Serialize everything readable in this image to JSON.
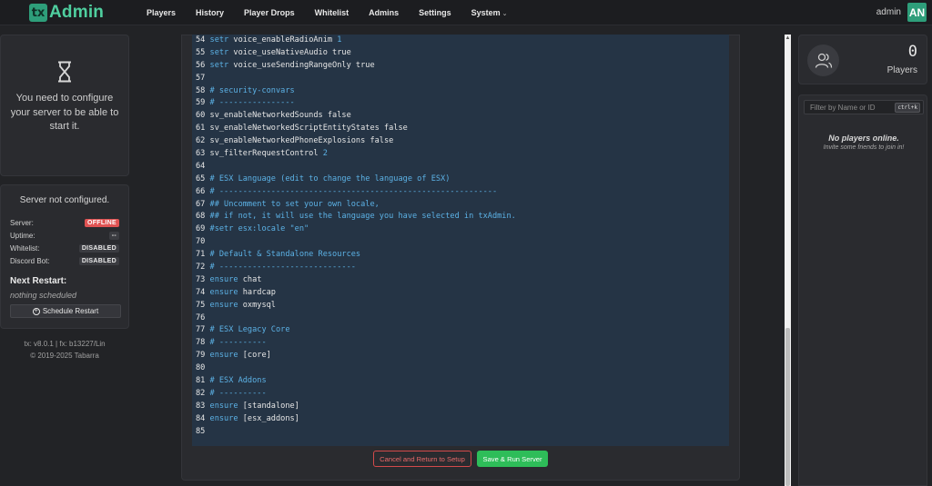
{
  "brand": {
    "tx": "tx",
    "name": "Admin"
  },
  "nav": {
    "items": [
      "Players",
      "History",
      "Player Drops",
      "Whitelist",
      "Admins",
      "Settings",
      "System"
    ],
    "user": "admin",
    "avatar": "AN"
  },
  "left": {
    "config_message": "You need to configure your server to be able to start it.",
    "status_title": "Server not configured.",
    "rows": [
      {
        "label": "Server:",
        "value": "OFFLINE"
      },
      {
        "label": "Uptime:",
        "value": "--"
      },
      {
        "label": "Whitelist:",
        "value": "DISABLED"
      },
      {
        "label": "Discord Bot:",
        "value": "DISABLED"
      }
    ],
    "next_restart_title": "Next Restart:",
    "next_restart_value": "nothing scheduled",
    "schedule_button": "Schedule Restart",
    "version_line": "tx: v8.0.1 | fx: b13227/Lin",
    "copyright": "© 2019-2025 Tabarra"
  },
  "editor": {
    "lines": [
      {
        "n": "54",
        "parts": [
          [
            "kw",
            "setr"
          ],
          [
            "t",
            " voice_enableRadioAnim "
          ],
          [
            "kw",
            "1"
          ]
        ]
      },
      {
        "n": "55",
        "parts": [
          [
            "kw",
            "setr"
          ],
          [
            "t",
            " voice_useNativeAudio true"
          ]
        ]
      },
      {
        "n": "56",
        "parts": [
          [
            "kw",
            "setr"
          ],
          [
            "t",
            " voice_useSendingRangeOnly true"
          ]
        ]
      },
      {
        "n": "57",
        "parts": []
      },
      {
        "n": "58",
        "parts": [
          [
            "cm",
            "# security-convars"
          ]
        ]
      },
      {
        "n": "59",
        "parts": [
          [
            "cm",
            "# ----------------"
          ]
        ]
      },
      {
        "n": "60",
        "parts": [
          [
            "t",
            "sv_enableNetworkedSounds false"
          ]
        ]
      },
      {
        "n": "61",
        "parts": [
          [
            "t",
            "sv_enableNetworkedScriptEntityStates false"
          ]
        ]
      },
      {
        "n": "62",
        "parts": [
          [
            "t",
            "sv_enableNetworkedPhoneExplosions false"
          ]
        ]
      },
      {
        "n": "63",
        "parts": [
          [
            "t",
            "sv_filterRequestControl "
          ],
          [
            "kw",
            "2"
          ]
        ]
      },
      {
        "n": "64",
        "parts": []
      },
      {
        "n": "65",
        "parts": [
          [
            "cm",
            "# ESX Language (edit to change the language of ESX)"
          ]
        ]
      },
      {
        "n": "66",
        "parts": [
          [
            "cm",
            "# -----------------------------------------------------------"
          ]
        ]
      },
      {
        "n": "67",
        "parts": [
          [
            "cm",
            "## Uncomment to set your own locale,"
          ]
        ]
      },
      {
        "n": "68",
        "parts": [
          [
            "cm",
            "## if not, it will use the language you have selected in txAdmin."
          ]
        ]
      },
      {
        "n": "69",
        "parts": [
          [
            "cm",
            "#setr esx:locale \"en\""
          ]
        ]
      },
      {
        "n": "70",
        "parts": []
      },
      {
        "n": "71",
        "parts": [
          [
            "cm",
            "# Default & Standalone Resources"
          ]
        ]
      },
      {
        "n": "72",
        "parts": [
          [
            "cm",
            "# -----------------------------"
          ]
        ]
      },
      {
        "n": "73",
        "parts": [
          [
            "kw",
            "ensure"
          ],
          [
            "t",
            " chat"
          ]
        ]
      },
      {
        "n": "74",
        "parts": [
          [
            "kw",
            "ensure"
          ],
          [
            "t",
            " hardcap"
          ]
        ]
      },
      {
        "n": "75",
        "parts": [
          [
            "kw",
            "ensure"
          ],
          [
            "t",
            " oxmysql"
          ]
        ]
      },
      {
        "n": "76",
        "parts": []
      },
      {
        "n": "77",
        "parts": [
          [
            "cm",
            "# ESX Legacy Core"
          ]
        ]
      },
      {
        "n": "78",
        "parts": [
          [
            "cm",
            "# ----------"
          ]
        ]
      },
      {
        "n": "79",
        "parts": [
          [
            "kw",
            "ensure"
          ],
          [
            "t",
            " [core]"
          ]
        ]
      },
      {
        "n": "80",
        "parts": []
      },
      {
        "n": "81",
        "parts": [
          [
            "cm",
            "# ESX Addons"
          ]
        ]
      },
      {
        "n": "82",
        "parts": [
          [
            "cm",
            "# ----------"
          ]
        ]
      },
      {
        "n": "83",
        "parts": [
          [
            "kw",
            "ensure"
          ],
          [
            "t",
            " [standalone]"
          ]
        ]
      },
      {
        "n": "84",
        "parts": [
          [
            "kw",
            "ensure"
          ],
          [
            "t",
            " [esx_addons]"
          ]
        ]
      },
      {
        "n": "85",
        "parts": []
      }
    ],
    "cancel_button": "Cancel and Return to Setup",
    "save_button": "Save & Run Server"
  },
  "right": {
    "player_count": "0",
    "players_label": "Players",
    "filter_placeholder": "Filter by Name or ID",
    "filter_shortcut": "ctrl+k",
    "no_players": "No players online.",
    "invite": "Invite some friends to join in!"
  },
  "colors": {
    "accent": "#2e9e7a",
    "editor_bg": "#253445",
    "keyword": "#5cb2e6",
    "offline": "#e05353",
    "save": "#2ebd59"
  }
}
